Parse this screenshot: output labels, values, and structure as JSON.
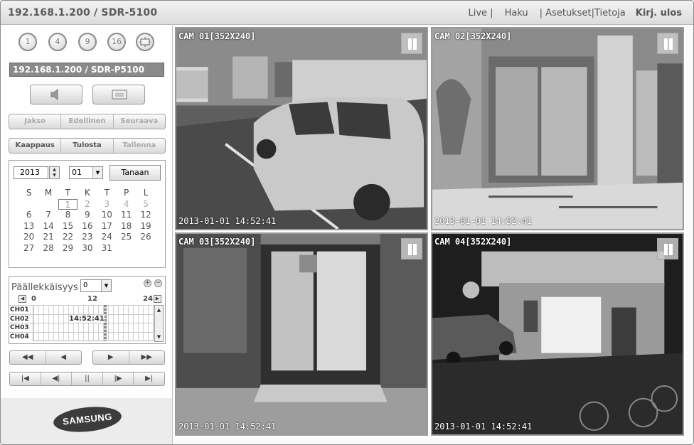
{
  "header": {
    "title": "192.168.1.200 / SDR-5100",
    "nav": {
      "live": "Live |",
      "search": "Haku",
      "settings": "| Asetukset| ",
      "info": "Tietoja",
      "logout": "Kirj. ulos"
    }
  },
  "sidebar": {
    "split_buttons": [
      "1",
      "4",
      "9",
      "16"
    ],
    "device_label": "192.168.1.200 / SDR-P5100",
    "segment1": [
      "Jakso",
      "Edellinen",
      "Seuraava"
    ],
    "segment2": [
      "Kaappaus",
      "Tulosta",
      "Tallenna"
    ],
    "calendar": {
      "year": "2013",
      "month": "01",
      "today_label": "Tanaan",
      "weekdays": [
        "S",
        "M",
        "T",
        "K",
        "T",
        "P",
        "L"
      ],
      "weeks": [
        [
          "",
          "",
          "1",
          "2",
          "3",
          "4",
          "5"
        ],
        [
          "6",
          "7",
          "8",
          "9",
          "10",
          "11",
          "12"
        ],
        [
          "13",
          "14",
          "15",
          "16",
          "17",
          "18",
          "19"
        ],
        [
          "20",
          "21",
          "22",
          "23",
          "24",
          "25",
          "26"
        ],
        [
          "27",
          "28",
          "29",
          "30",
          "31",
          "",
          ""
        ]
      ]
    },
    "overlap": {
      "label": "Päällekkäisyys",
      "value": "0",
      "axis": [
        "0",
        "12",
        "24"
      ],
      "channels": [
        "CH01",
        "CH02",
        "CH03",
        "CH04"
      ],
      "time": "14:52:41"
    },
    "brand": "SAMSUNG"
  },
  "cameras": [
    {
      "label": "CAM 01[352X240]",
      "timestamp": "2013-01-01  14:52:41"
    },
    {
      "label": "CAM 02[352X240]",
      "timestamp": "2013-01-01  14:52:41"
    },
    {
      "label": "CAM 03[352X240]",
      "timestamp": "2013-01-01  14:52:41"
    },
    {
      "label": "CAM 04[352X240]",
      "timestamp": "2013-01-01  14:52:41"
    }
  ]
}
